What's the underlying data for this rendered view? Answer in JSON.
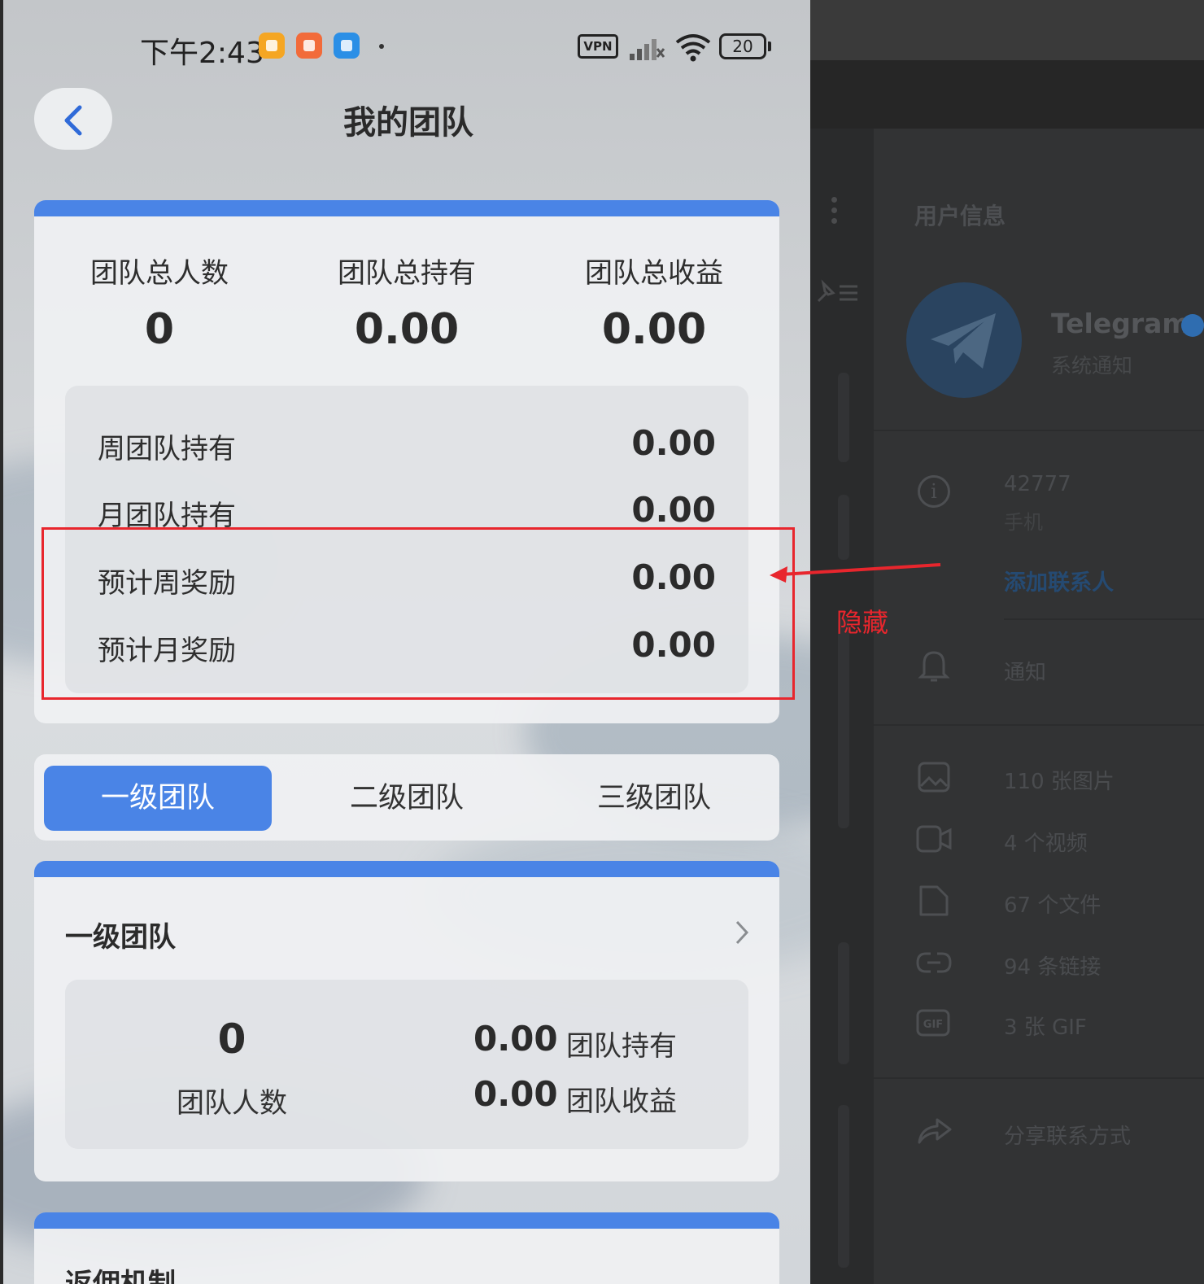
{
  "status_bar": {
    "time": "下午2:43",
    "vpn_label": "VPN",
    "battery": "20"
  },
  "header": {
    "title": "我的团队"
  },
  "summary": {
    "stats": [
      {
        "label": "团队总人数",
        "value": "0"
      },
      {
        "label": "团队总持有",
        "value": "0.00"
      },
      {
        "label": "团队总收益",
        "value": "0.00"
      }
    ],
    "rows": [
      {
        "label": "周团队持有",
        "value": "0.00"
      },
      {
        "label": "月团队持有",
        "value": "0.00"
      },
      {
        "label": "预计周奖励",
        "value": "0.00"
      },
      {
        "label": "预计月奖励",
        "value": "0.00"
      }
    ]
  },
  "tabs": [
    {
      "label": "一级团队",
      "active": true
    },
    {
      "label": "二级团队",
      "active": false
    },
    {
      "label": "三级团队",
      "active": false
    }
  ],
  "team_card": {
    "title": "一级团队",
    "count": "0",
    "count_label": "团队人数",
    "holding_value": "0.00",
    "holding_label": "团队持有",
    "earnings_value": "0.00",
    "earnings_label": "团队收益"
  },
  "rebate_card": {
    "title": "返佣机制"
  },
  "annotation": {
    "text": "隐藏",
    "color": "#e8262d"
  },
  "desktop_panel": {
    "title": "用户信息",
    "name": "Telegram",
    "subtitle": "系统通知",
    "phone_number": "42777",
    "phone_label": "手机",
    "add_contact": "添加联系人",
    "notifications": "通知",
    "media": [
      {
        "icon": "image-icon",
        "label": "110 张图片"
      },
      {
        "icon": "video-icon",
        "label": "4 个视频"
      },
      {
        "icon": "file-icon",
        "label": "67 个文件"
      },
      {
        "icon": "link-icon",
        "label": "94 条链接"
      },
      {
        "icon": "gif-icon",
        "label": "3 张 GIF"
      }
    ],
    "share": "分享联系方式"
  },
  "colors": {
    "accent": "#4a84e6",
    "annotation": "#e8262d"
  }
}
